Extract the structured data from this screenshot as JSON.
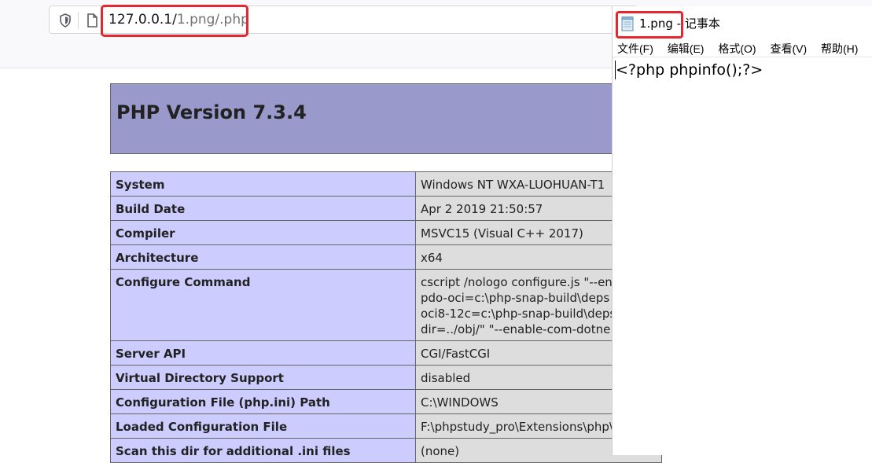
{
  "browser": {
    "url_host": "127.0.0.1/",
    "url_path": "1.png/.php"
  },
  "phpinfo": {
    "title": "PHP Version 7.3.4",
    "rows": [
      {
        "key": "System",
        "value": [
          "Windows NT WXA-LUOHUAN-T1"
        ]
      },
      {
        "key": "Build Date",
        "value": [
          "Apr 2 2019 21:50:57"
        ]
      },
      {
        "key": "Compiler",
        "value": [
          "MSVC15 (Visual C++ 2017)"
        ]
      },
      {
        "key": "Architecture",
        "value": [
          "x64"
        ]
      },
      {
        "key": "Configure Command",
        "value": [
          "cscript /nologo configure.js \"--en",
          "pdo-oci=c:\\php-snap-build\\deps",
          "oci8-12c=c:\\php-snap-build\\deps",
          "dir=../obj/\" \"--enable-com-dotne"
        ]
      },
      {
        "key": "Server API",
        "value": [
          "CGI/FastCGI"
        ]
      },
      {
        "key": "Virtual Directory Support",
        "value": [
          "disabled"
        ]
      },
      {
        "key": "Configuration File (php.ini) Path",
        "value": [
          "C:\\WINDOWS"
        ]
      },
      {
        "key": "Loaded Configuration File",
        "value": [
          "F:\\phpstudy_pro\\Extensions\\php\\"
        ]
      },
      {
        "key": "Scan this dir for additional .ini files",
        "value": [
          "(none)"
        ]
      }
    ]
  },
  "notepad": {
    "title_file": "1.png",
    "title_sep": " - ",
    "title_app": "记事本",
    "menu": [
      "文件(F)",
      "编辑(E)",
      "格式(O)",
      "查看(V)",
      "帮助(H)"
    ],
    "content": "<?php phpinfo();?>"
  },
  "colors": {
    "highlight": "#e8262d",
    "php_header": "#9999cc",
    "php_key": "#ccccff",
    "php_value": "#dddddd"
  }
}
